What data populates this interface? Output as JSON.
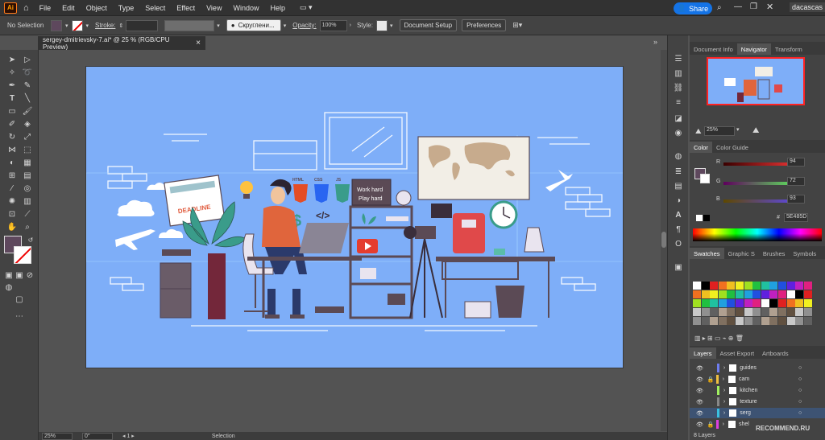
{
  "app": {
    "logo": "Ai"
  },
  "menu": [
    "File",
    "Edit",
    "Object",
    "Type",
    "Select",
    "Effect",
    "View",
    "Window",
    "Help"
  ],
  "topbar": {
    "share_label": "Share",
    "username": "dacascas"
  },
  "control": {
    "selection": "No Selection",
    "stroke_label": "Stroke:",
    "brush": "Скруглени...",
    "opacity_label": "Opacity:",
    "opacity_value": "100%",
    "style_label": "Style:",
    "doc_setup": "Document Setup",
    "preferences": "Preferences"
  },
  "document": {
    "tab_title": "sergey-dmitrievsky-7.ai* @ 25 % (RGB/CPU Preview)",
    "close": "×"
  },
  "artwork": {
    "html_badge": "HTML",
    "css_badge": "CSS",
    "js_badge": "JS",
    "sign_line1": "Work hard",
    "sign_line2": "Play hard",
    "deadline": "DEADLINE",
    "code_glyph": "</>",
    "dollar": "$"
  },
  "panels": {
    "top_tabs": [
      "Document Info",
      "Navigator",
      "Transform"
    ],
    "navigator_zoom": "25%",
    "color_tabs": [
      "Color",
      "Color Guide"
    ],
    "color": {
      "r_label": "R",
      "r_value": "94",
      "g_label": "G",
      "g_value": "72",
      "b_label": "B",
      "b_value": "93",
      "hex_label": "#",
      "hex": "5E485D",
      "current": "#5e485d"
    },
    "swatch_tabs": [
      "Swatches",
      "Graphic S",
      "Brushes",
      "Symbols"
    ],
    "layer_tabs": [
      "Layers",
      "Asset Export",
      "Artboards"
    ],
    "layers": [
      "guides",
      "cam",
      "kitchen",
      "texture",
      "serg",
      "shel"
    ],
    "layers_count": "8 Layers"
  },
  "status": {
    "zoom": "25%",
    "rotation": "0°",
    "tool": "Selection"
  },
  "watermark": "RECOMMEND.RU"
}
